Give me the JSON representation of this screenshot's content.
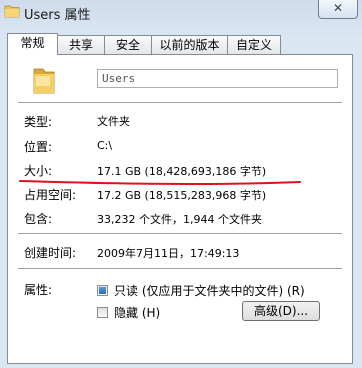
{
  "window": {
    "title": "Users 属性",
    "close_icon": "close-icon"
  },
  "tabs": [
    {
      "label": "常规",
      "active": true
    },
    {
      "label": "共享",
      "active": false
    },
    {
      "label": "安全",
      "active": false
    },
    {
      "label": "以前的版本",
      "active": false
    },
    {
      "label": "自定义",
      "active": false
    }
  ],
  "general": {
    "folder_icon": "folder-icon",
    "name_value": "Users",
    "type_label": "类型:",
    "type_value": "文件夹",
    "location_label": "位置:",
    "location_value": "C:\\",
    "size_label": "大小:",
    "size_value": "17.1 GB (18,428,693,186 字节)",
    "disk_size_label": "占用空间:",
    "disk_size_value": "17.2 GB (18,515,283,968 字节)",
    "contains_label": "包含:",
    "contains_value": "33,232 个文件，1,944 个文件夹",
    "created_label": "创建时间:",
    "created_value": "2009年7月11日，17:49:13",
    "attributes_label": "属性:",
    "readonly_label": "只读 (仅应用于文件夹中的文件) (R)",
    "hidden_label": "隐藏 (H)",
    "advanced_label": "高级(D)...",
    "readonly_state": "indeterminate",
    "hidden_state": "unchecked"
  },
  "annotation": {
    "underline_color": "#e0101c"
  }
}
